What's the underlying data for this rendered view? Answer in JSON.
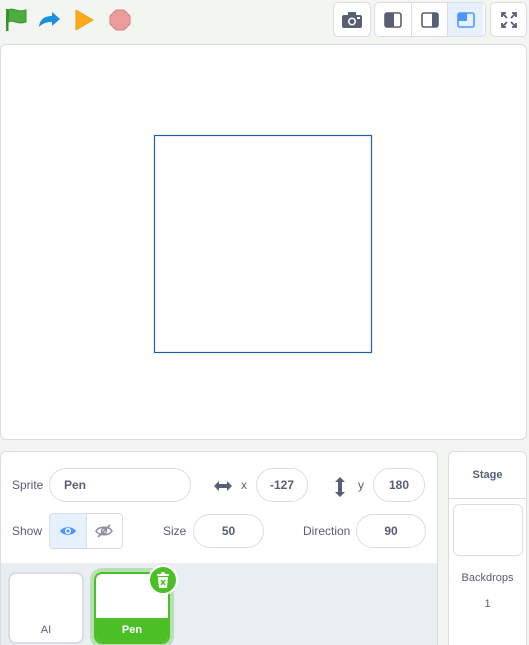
{
  "toolbar": {
    "green_flag_icon": "green-flag-icon",
    "redo_icon": "redo-arrow-icon",
    "run_icon": "orange-play-icon",
    "stop_icon": "stop-icon",
    "screenshot_icon": "camera-icon",
    "layout_buttons": [
      "small-stage-icon",
      "normal-stage-icon",
      "tiled-stage-icon"
    ],
    "active_layout": "tiled-stage-icon",
    "fullscreen_icon": "fullscreen-icon"
  },
  "stage": {
    "drawn_shape": "square-outline",
    "stroke_color": "#1f5fa8"
  },
  "sprite_info": {
    "sprite_label": "Sprite",
    "sprite_name": "Pen",
    "x_label": "x",
    "x_value": "-127",
    "y_label": "y",
    "y_value": "180",
    "show_label": "Show",
    "size_label": "Size",
    "size_value": "50",
    "direction_label": "Direction",
    "direction_value": "90"
  },
  "sprites": [
    {
      "name": "AI",
      "selected": false
    },
    {
      "name": "Pen",
      "selected": true
    }
  ],
  "stage_pane": {
    "header": "Stage",
    "backdrops_label": "Backdrops",
    "backdrops_count": "1"
  },
  "colors": {
    "accent_green": "#4cbf26",
    "flag_green": "#4cae3d",
    "redo_blue": "#1c8fe0",
    "run_orange": "#ffab19",
    "stop_red": "#ec9c9c",
    "text": "#575e75",
    "border": "#d9dde3"
  }
}
